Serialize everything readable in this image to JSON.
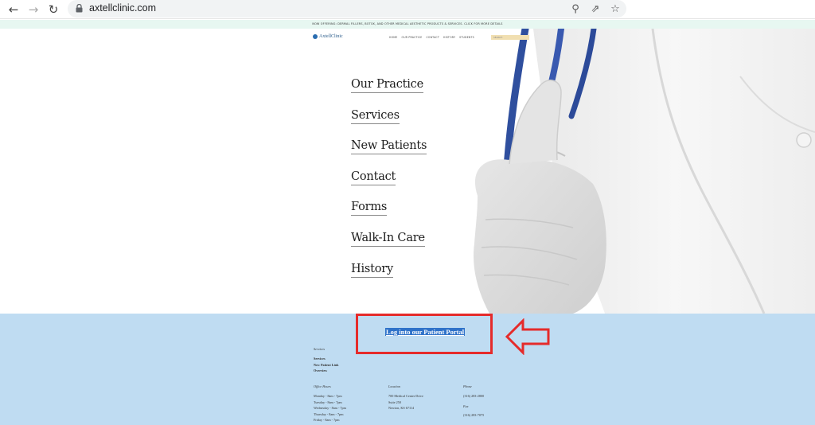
{
  "browser": {
    "url": "axtellclinic.com"
  },
  "site": {
    "announcement": "NOW OFFERING: DERMAL FILLERS, BOTOX, AND OTHER MEDICAL AESTHETIC PRODUCTS & SERVICES. CLICK FOR MORE DETAILS",
    "logo_text": "AxtellClinic",
    "top_nav": [
      "HOME",
      "OUR PRACTICE",
      "CONTACT",
      "HISTORY",
      "STUDENTS"
    ],
    "search_placeholder": "SEARCH"
  },
  "menu": {
    "items": [
      "Our Practice",
      "Services",
      "New Patients",
      "Contact",
      "Forms",
      "Walk-In Care",
      "History"
    ]
  },
  "footer": {
    "portal_label": "Log into our Patient Portal",
    "services_heading": "Services",
    "services_links": [
      "Services",
      "New Patient Link",
      "Overview"
    ],
    "hours_heading": "Office Hours",
    "hours": [
      "Monday - 8am - 7pm",
      "Tuesday - 8am - 7pm",
      "Wednesday - 8am - 7pm",
      "Thursday - 8am - 7pm",
      "Friday - 8am - 7pm"
    ],
    "location_heading": "Location",
    "location": [
      "700 Medical Center Drive",
      "Suite 250",
      "Newton, KS 67114"
    ],
    "phone_heading": "Phone",
    "phone": "(316) 283-2800",
    "fax_heading": "Fax",
    "fax": "(316) 283-7075"
  },
  "colors": {
    "footer_bg": "#bfdcf2",
    "portal_highlight": "#2f72c9",
    "annotation_red": "#e52b2b",
    "announcement_bg": "#e7f7f1"
  }
}
